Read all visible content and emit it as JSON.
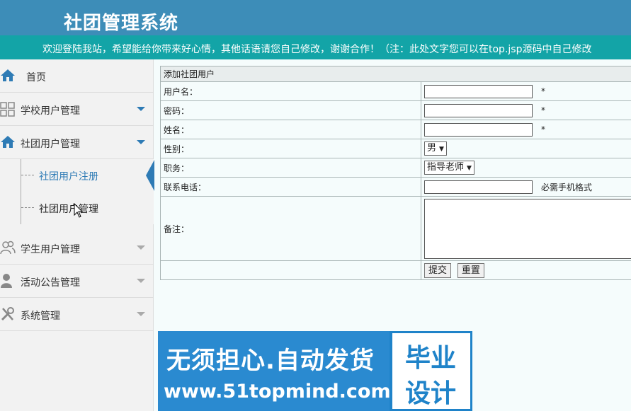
{
  "header": {
    "title": "社团管理系统",
    "marquee": "欢迎登陆我站，希望能给你带来好心情，其他话语请您自己修改，谢谢合作！（注：此处文字您可以在top.jsp源码中自己修改"
  },
  "sidebar": {
    "items": [
      {
        "label": "首页",
        "icon": "home-icon"
      },
      {
        "label": "学校用户管理",
        "icon": "grid-icon"
      },
      {
        "label": "社团用户管理",
        "icon": "home-icon"
      },
      {
        "label": "学生用户管理",
        "icon": "users-icon"
      },
      {
        "label": "活动公告管理",
        "icon": "user-icon"
      },
      {
        "label": "系统管理",
        "icon": "tools-icon"
      }
    ],
    "submenu": [
      {
        "label": "社团用户注册",
        "active": true
      },
      {
        "label": "社团用户管理",
        "active": false
      }
    ]
  },
  "form": {
    "caption": "添加社团用户",
    "fields": {
      "username_label": "用户名：",
      "password_label": "密码：",
      "name_label": "姓名：",
      "gender_label": "性别：",
      "gender_value": "男",
      "position_label": "职务：",
      "position_value": "指导老师",
      "phone_label": "联系电话：",
      "phone_hint": "必需手机格式",
      "remark_label": "备注：",
      "required_mark": "*"
    },
    "buttons": {
      "submit": "提交",
      "reset": "重置"
    }
  },
  "banner": {
    "line1": "无须担心.自动发货",
    "line2": "www.51topmind.com",
    "right1": "毕业",
    "right2": "设计"
  },
  "colors": {
    "header": "#3d8db8",
    "marquee": "#13a4a7",
    "accent": "#2e7bb5",
    "banner": "#1f83c9"
  }
}
